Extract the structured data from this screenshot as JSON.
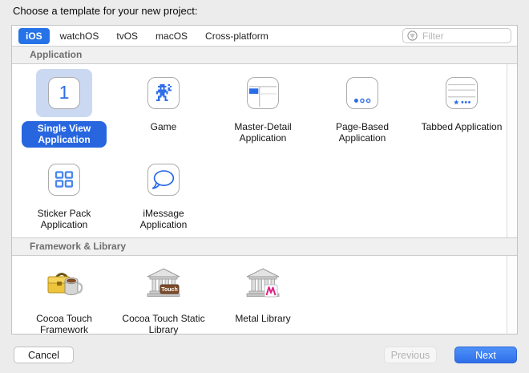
{
  "window": {
    "title": "Choose a template for your new project:"
  },
  "toolbar": {
    "tabs": [
      {
        "label": "iOS",
        "selected": true
      },
      {
        "label": "watchOS",
        "selected": false
      },
      {
        "label": "tvOS",
        "selected": false
      },
      {
        "label": "macOS",
        "selected": false
      },
      {
        "label": "Cross-platform",
        "selected": false
      }
    ],
    "filter_placeholder": "Filter",
    "filter_icon": "filter-icon"
  },
  "sections": [
    {
      "title": "Application",
      "items": [
        {
          "label": "Single View Application",
          "icon": "single-view-icon",
          "icon_text": "1",
          "selected": true
        },
        {
          "label": "Game",
          "icon": "game-icon",
          "selected": false
        },
        {
          "label": "Master-Detail Application",
          "icon": "master-detail-icon",
          "selected": false
        },
        {
          "label": "Page-Based Application",
          "icon": "page-based-icon",
          "selected": false
        },
        {
          "label": "Tabbed Application",
          "icon": "tabbed-icon",
          "selected": false
        },
        {
          "label": "Sticker Pack Application",
          "icon": "sticker-pack-icon",
          "selected": false
        },
        {
          "label": "iMessage Application",
          "icon": "imessage-icon",
          "selected": false
        }
      ]
    },
    {
      "title": "Framework & Library",
      "items": [
        {
          "label": "Cocoa Touch Framework",
          "icon": "toolbox-icon",
          "selected": false
        },
        {
          "label": "Cocoa Touch Static Library",
          "icon": "bank-touch-icon",
          "badge": "Touch",
          "selected": false
        },
        {
          "label": "Metal Library",
          "icon": "bank-metal-icon",
          "selected": false
        }
      ]
    }
  ],
  "footer": {
    "cancel_label": "Cancel",
    "previous_label": "Previous",
    "next_label": "Next",
    "previous_enabled": false
  },
  "colors": {
    "accent_blue": "#2a6be8",
    "selected_tab_bg": "#2573e6",
    "selection_bg": "#cbd8f1",
    "selected_label_bg": "#2866e0",
    "header_bg": "#f0f0f0",
    "window_bg": "#ececec"
  }
}
